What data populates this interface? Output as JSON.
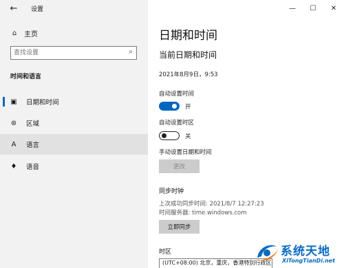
{
  "window": {
    "title": "设置",
    "controls": [
      "—",
      "☐",
      "✕"
    ]
  },
  "sidebar": {
    "back_icon": "←",
    "home": {
      "icon": "⌂",
      "label": "主页"
    },
    "search": {
      "placeholder": "查找设置",
      "value": "",
      "icon": "⌕"
    },
    "section_title": "时间和语言",
    "items": [
      {
        "icon": "▣",
        "label": "日期和时间",
        "active": true
      },
      {
        "icon": "⊛",
        "label": "区域",
        "active": false
      },
      {
        "icon": "A",
        "label": "语言",
        "active": false,
        "highlighted": true
      },
      {
        "icon": "♦",
        "label": "语音",
        "active": false
      }
    ]
  },
  "main": {
    "title": "日期和时间",
    "subtitle": "当前日期和时间",
    "current_datetime": "2021年8月9日，9:53",
    "auto_time": {
      "label": "自动设置时间",
      "state": "开",
      "on": true
    },
    "auto_timezone": {
      "label": "自动设置时区",
      "state": "关",
      "on": false
    },
    "manual": {
      "label": "手动设置日期和时间",
      "button": "更改"
    },
    "sync": {
      "heading": "同步时钟",
      "last_sync": "上次成功同步时间: 2021/8/7 12:27:23",
      "server": "时间服务器: time.windows.com",
      "button": "立即同步"
    },
    "timezone": {
      "heading": "时区",
      "value": "(UTC+08:00) 北京，重庆，香港特别行政区"
    }
  },
  "watermark": {
    "title": "系统天地",
    "subtitle": "XiTongTianDi.net",
    "colors": {
      "primary": "#0a6bc1",
      "accent": "#f07a1a"
    }
  },
  "colors": {
    "accent": "#0067c0",
    "sidebar_bg": "#f2f2f2",
    "button_bg": "#cccccc"
  }
}
